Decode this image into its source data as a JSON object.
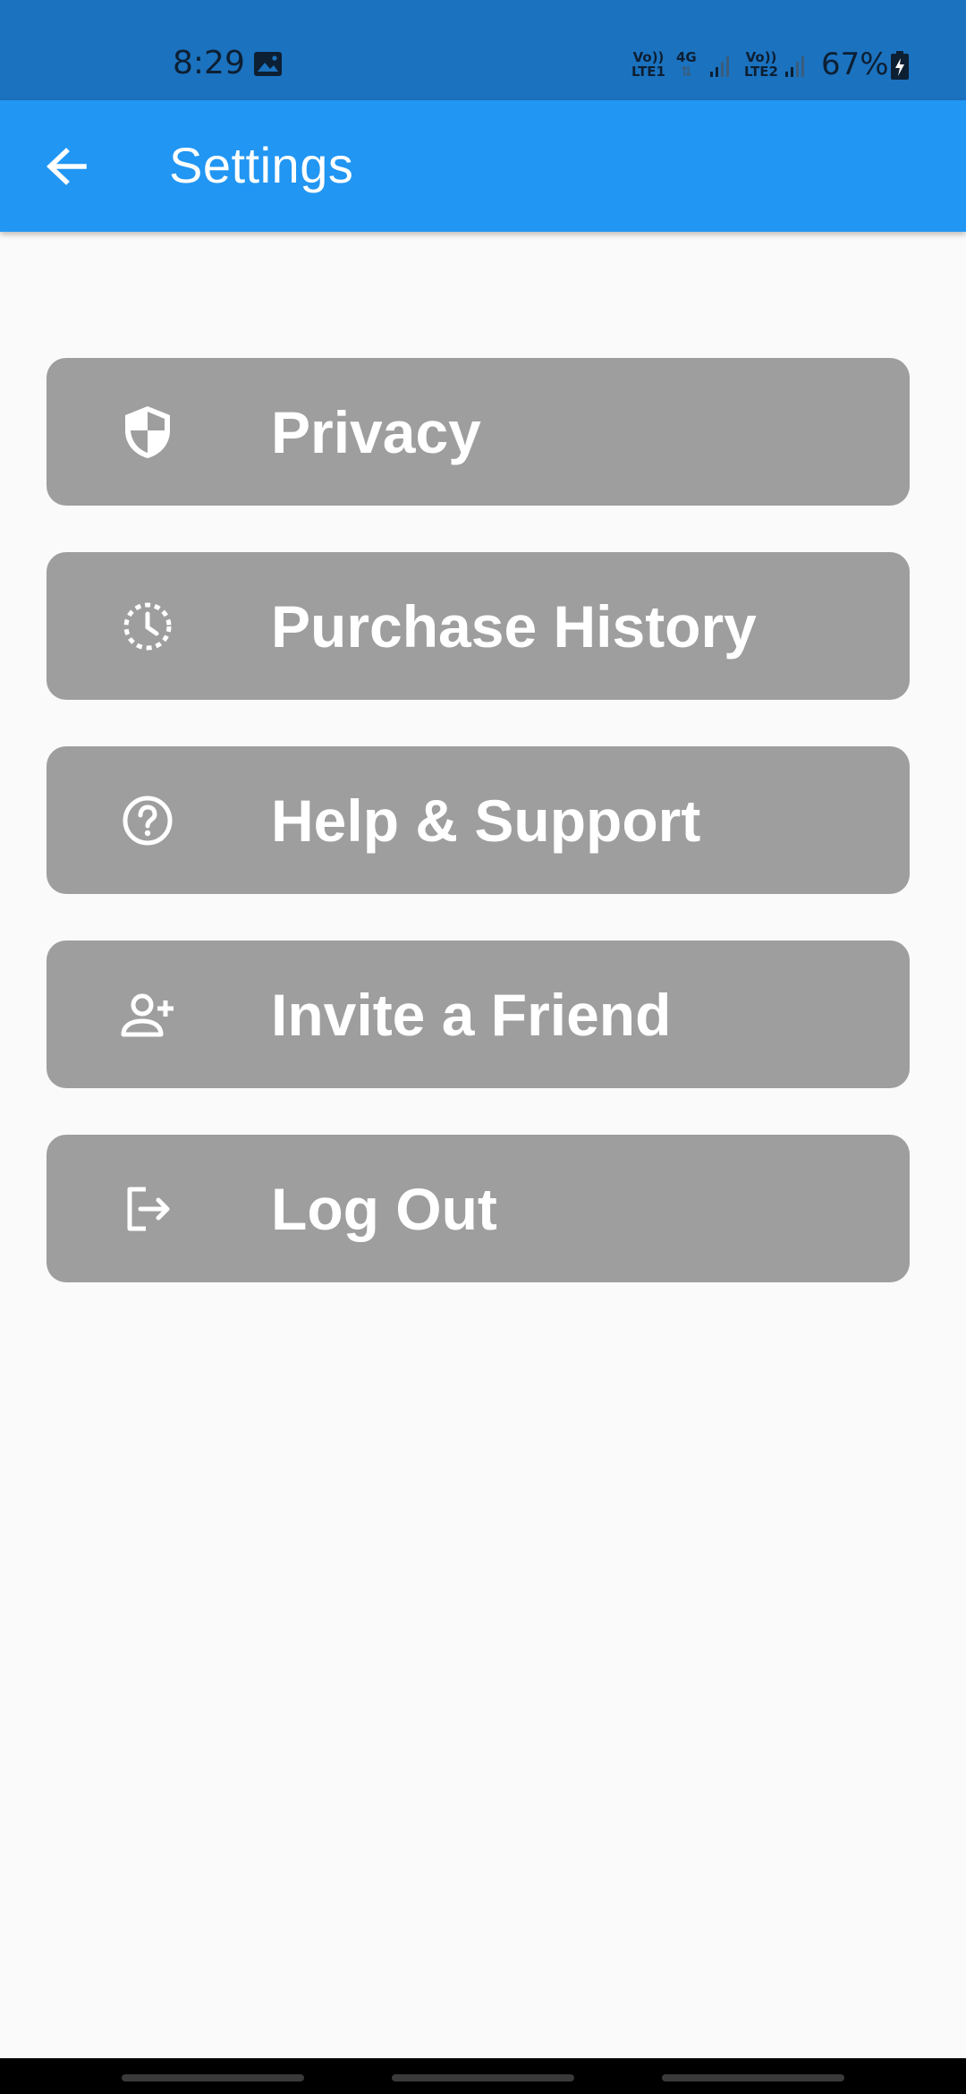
{
  "status_bar": {
    "time": "8:29",
    "net1_top": "Vo))",
    "net1_bottom": "LTE1",
    "net_type": "4G",
    "net2_top": "Vo))",
    "net2_bottom": "LTE2",
    "battery_percent": "67%",
    "battery_level": 67
  },
  "app_bar": {
    "title": "Settings",
    "back_icon": "arrow-back-icon",
    "color": "#2196f3"
  },
  "menu": {
    "items": [
      {
        "label": "Privacy",
        "icon": "shield-icon"
      },
      {
        "label": "Purchase History",
        "icon": "history-icon"
      },
      {
        "label": "Help & Support",
        "icon": "help-icon"
      },
      {
        "label": "Invite a Friend",
        "icon": "person-add-icon"
      },
      {
        "label": "Log Out",
        "icon": "logout-icon"
      }
    ],
    "item_color": "#9e9e9e"
  }
}
